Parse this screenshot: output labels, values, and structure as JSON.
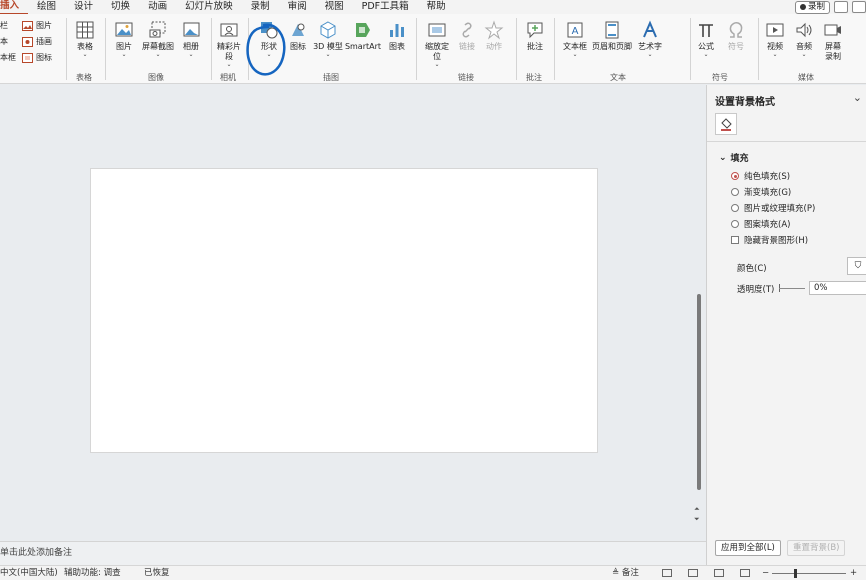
{
  "menu": {
    "tabs": [
      "插入",
      "绘图",
      "设计",
      "切换",
      "动画",
      "幻灯片放映",
      "录制",
      "审阅",
      "视图",
      "PDF工具箱",
      "帮助"
    ],
    "active_tab": "插入",
    "record_label": "录制"
  },
  "ribbon": {
    "text_partial": {
      "line1": "栏",
      "line2": "本",
      "line3": "本框"
    },
    "small_items": [
      "图片",
      "插画",
      "图标"
    ],
    "table_label": "表格",
    "image_buttons": {
      "picture": "图片",
      "screenshot": "屏幕截图",
      "album": "相册"
    },
    "camera_button": "精彩片段",
    "illust_buttons": {
      "shapes": "形状",
      "icons": "图标",
      "model3d": "3D 模型",
      "smartart": "SmartArt",
      "chart": "图表"
    },
    "link_buttons": {
      "zoom": "缩放定位",
      "link": "链接",
      "action": "动作"
    },
    "comment_button": "批注",
    "text_buttons": {
      "textbox": "文本框",
      "header_footer": "页眉和页脚",
      "wordart": "艺术字"
    },
    "symbol_buttons": {
      "equation": "公式",
      "symbol": "符号"
    },
    "media_buttons": {
      "video": "视频",
      "audio": "音频",
      "screen_rec": "屏幕录制"
    },
    "groups": {
      "tables": "表格",
      "images": "图像",
      "camera": "相机",
      "illustrations": "插图",
      "links": "链接",
      "comments": "批注",
      "text": "文本",
      "symbols": "符号",
      "media": "媒体"
    }
  },
  "notes_placeholder": "单击此处添加备注",
  "pane": {
    "title": "设置背景格式",
    "section": "填充",
    "options": [
      "纯色填充(S)",
      "渐变填充(G)",
      "图片或纹理填充(P)",
      "图案填充(A)"
    ],
    "selected_option": "纯色填充(S)",
    "hide_bg": "隐藏背景图形(H)",
    "color_label": "颜色(C)",
    "transparency_label": "透明度(T)",
    "transparency_value": "0%",
    "apply_all": "应用到全部(L)",
    "reset": "重置背景(B)"
  },
  "status": {
    "language": "中文(中国大陆)",
    "accessibility": "辅助功能: 调查",
    "recovered": "已恢复",
    "notes_btn": "备注"
  },
  "colors": {
    "accent": "#b7472a",
    "annotation": "#1565c0"
  }
}
